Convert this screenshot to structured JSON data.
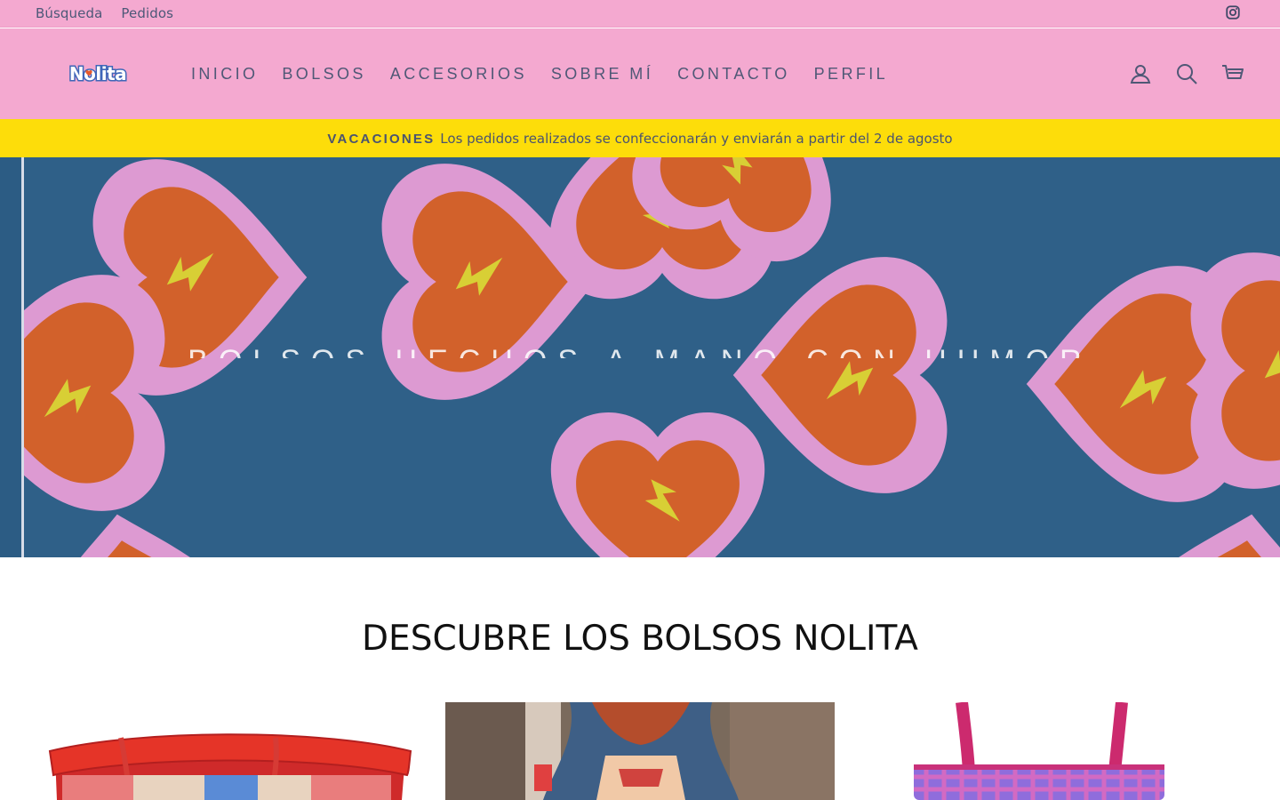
{
  "utility": {
    "links": [
      {
        "label": "Búsqueda"
      },
      {
        "label": "Pedidos"
      }
    ],
    "social_icon": "instagram-icon"
  },
  "header": {
    "logo_text": "Nolita",
    "nav": [
      {
        "label": "INICIO"
      },
      {
        "label": "BOLSOS"
      },
      {
        "label": "ACCESORIOS"
      },
      {
        "label": "SOBRE MÍ"
      },
      {
        "label": "CONTACTO"
      },
      {
        "label": "PERFIL"
      }
    ],
    "icons": [
      "account-icon",
      "search-icon",
      "cart-icon"
    ]
  },
  "announcement": {
    "strong": "VACACIONES",
    "text": "Los pedidos realizados se confeccionarán y enviarán a partir del 2 de agosto"
  },
  "hero": {
    "title": "BOLSOS HECHOS A MANO CON HUMOR"
  },
  "section": {
    "title": "DESCUBRE LOS BOLSOS NOLITA"
  },
  "colors": {
    "pink": "#f4a9d0",
    "yellow": "#fddd0a",
    "nav_text": "#4f5876",
    "hero_blue": "#2f6088"
  }
}
